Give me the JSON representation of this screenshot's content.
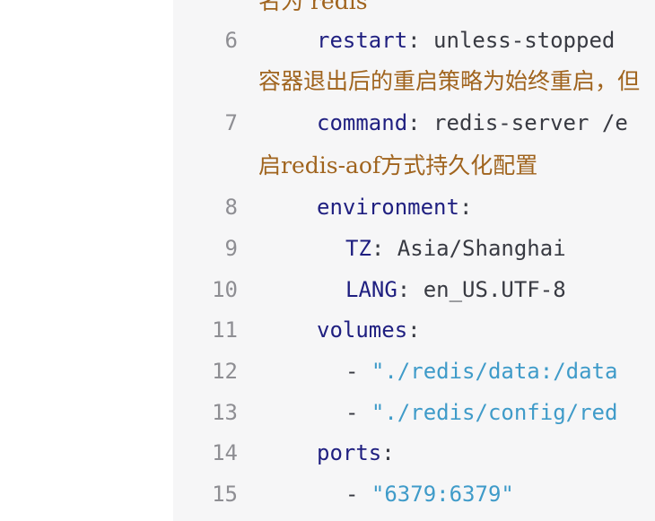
{
  "colors": {
    "key": "#1f1f80",
    "string": "#3f9bc9",
    "comment": "#a0641e",
    "line_number": "#8e8e93",
    "background": "#f6f6f7"
  },
  "lines": {
    "l5_tail": {
      "comment": "名为 redis"
    },
    "l6": {
      "num": "6",
      "key": "restart",
      "colon": ":",
      "value": " unless-stopped"
    },
    "l6_cn": {
      "comment": "容器退出后的重启策略为始终重启，但"
    },
    "l7": {
      "num": "7",
      "key": "command",
      "colon": ":",
      "value": " redis-server /e"
    },
    "l7_cn": {
      "comment": "启redis-aof方式持久化配置"
    },
    "l8": {
      "num": "8",
      "key": "environment",
      "colon": ":"
    },
    "l9": {
      "num": "9",
      "key": "TZ",
      "colon": ":",
      "value": " Asia/Shanghai"
    },
    "l10": {
      "num": "10",
      "key": "LANG",
      "colon": ":",
      "value": " en_US.UTF-8"
    },
    "l11": {
      "num": "11",
      "key": "volumes",
      "colon": ":"
    },
    "l12": {
      "num": "12",
      "dash": "- ",
      "string": "\"./redis/data:/data"
    },
    "l13": {
      "num": "13",
      "dash": "- ",
      "string": "\"./redis/config/red"
    },
    "l14": {
      "num": "14",
      "key": "ports",
      "colon": ":"
    },
    "l15": {
      "num": "15",
      "dash": "- ",
      "string": "\"6379:6379\""
    }
  }
}
